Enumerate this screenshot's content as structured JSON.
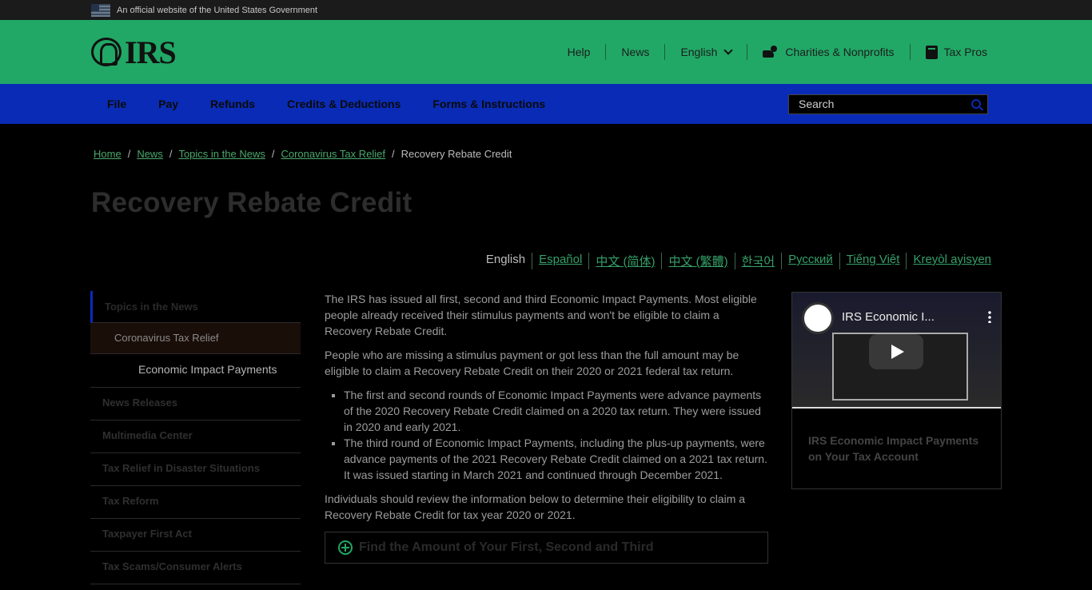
{
  "gov_banner": {
    "text": "An official website of the United States Government"
  },
  "header": {
    "logo_text": "IRS",
    "nav": [
      "Help",
      "News",
      "English",
      "Charities & Nonprofits",
      "Tax Pros"
    ]
  },
  "mainnav": {
    "items": [
      "File",
      "Pay",
      "Refunds",
      "Credits & Deductions",
      "Forms & Instructions"
    ],
    "search_placeholder": "Search"
  },
  "breadcrumb": [
    "Home",
    "News",
    "Topics in the News",
    "Coronavirus Tax Relief",
    "Recovery Rebate Credit"
  ],
  "page_title": "Recovery Rebate Credit",
  "languages": [
    "English",
    "Español",
    "中文 (简体)",
    "中文 (繁體)",
    "한국어",
    "Русский",
    "Tiếng Việt",
    "Kreyòl ayisyen"
  ],
  "sidebar": {
    "items": [
      "Topics in the News",
      "Coronavirus Tax Relief",
      "Economic Impact Payments",
      "News Releases",
      "Multimedia Center",
      "Tax Relief in Disaster Situations",
      "Tax Reform",
      "Taxpayer First Act",
      "Tax Scams/Consumer Alerts"
    ]
  },
  "main": {
    "p1": "The IRS has issued all first, second and third Economic Impact Payments. Most eligible people already received their stimulus payments and won't be eligible to claim a Recovery Rebate Credit.",
    "p2": "People who are missing a stimulus payment or got less than the full amount may be eligible to claim a Recovery Rebate Credit on their 2020 or 2021 federal tax return.",
    "bullets": [
      "The first and second rounds of Economic Impact Payments were advance payments of the 2020 Recovery Rebate Credit claimed on a 2020 tax return. They were issued in 2020 and early 2021.",
      "The third round of Economic Impact Payments, including the plus-up payments, were advance payments of the 2021 Recovery Rebate Credit claimed on a 2021 tax return. It was issued starting in March 2021 and continued through December 2021."
    ],
    "p3": "Individuals should review the information below to determine their eligibility to claim a Recovery Rebate Credit for tax year 2020 or 2021.",
    "accordion_title": "Find the Amount of Your First, Second and Third"
  },
  "video": {
    "title": "IRS Economic I...",
    "caption": "IRS Economic Impact Payments on Your Tax Account"
  },
  "colors": {
    "header_green": "#21a866",
    "nav_blue": "#0a2bb5",
    "link_green": "#35a068"
  }
}
